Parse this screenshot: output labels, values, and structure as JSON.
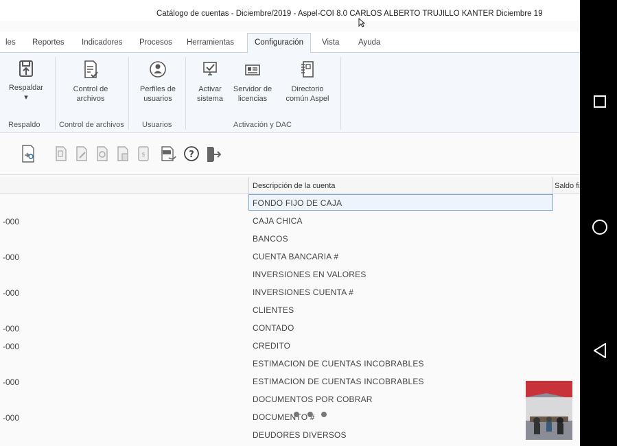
{
  "window": {
    "title": "Catálogo de cuentas - Diciembre/2019 - Aspel-COI 8.0 CARLOS ALBERTO TRUJILLO KANTER Diciembre 19"
  },
  "menu": [
    {
      "label": "les"
    },
    {
      "label": "Reportes"
    },
    {
      "label": "Indicadores"
    },
    {
      "label": "Procesos"
    },
    {
      "label": "Herramientas"
    },
    {
      "label": "Configuración"
    },
    {
      "label": "Vista"
    },
    {
      "label": "Ayuda"
    }
  ],
  "ribbon": {
    "buttons": [
      {
        "label": "Respaldar\n▾",
        "icon": "backup-icon"
      },
      {
        "label": "Control de\narchivos",
        "icon": "file-control-icon"
      },
      {
        "label": "Perfiles de\nusuarios",
        "icon": "user-profile-icon"
      },
      {
        "label": "Activar\nsistema",
        "icon": "activate-icon"
      },
      {
        "label": "Servidor de\nlicencias",
        "icon": "license-server-icon"
      },
      {
        "label": "Directorio\ncomún Aspel",
        "icon": "directory-icon"
      }
    ],
    "groups": [
      {
        "label": "Respaldo"
      },
      {
        "label": "Control de archivos"
      },
      {
        "label": "Usuarios"
      },
      {
        "label": "Activación y DAC"
      }
    ]
  },
  "grid": {
    "headers": {
      "description": "Descripción de la cuenta",
      "saldo": "Saldo fi"
    },
    "rows": [
      {
        "num": "",
        "desc": "FONDO FIJO DE CAJA"
      },
      {
        "num": "-000",
        "desc": "CAJA CHICA"
      },
      {
        "num": "",
        "desc": "BANCOS"
      },
      {
        "num": "-000",
        "desc": "CUENTA BANCARIA #"
      },
      {
        "num": "",
        "desc": "INVERSIONES EN VALORES"
      },
      {
        "num": "-000",
        "desc": "INVERSIONES CUENTA #"
      },
      {
        "num": "",
        "desc": "CLIENTES"
      },
      {
        "num": "-000",
        "desc": "CONTADO"
      },
      {
        "num": "-000",
        "desc": "CREDITO"
      },
      {
        "num": "",
        "desc": "ESTIMACION DE CUENTAS INCOBRABLES"
      },
      {
        "num": "-000",
        "desc": "ESTIMACION DE CUENTAS INCOBRABLES"
      },
      {
        "num": "",
        "desc": "DOCUMENTOS POR COBRAR"
      },
      {
        "num": "-000",
        "desc": "DOCUMENTO #"
      },
      {
        "num": "",
        "desc": "DEUDORES DIVERSOS"
      }
    ]
  },
  "colors": {
    "accent": "#2b6cb0",
    "selection_border": "#7aa3d6",
    "ribbon_bg": "#f4f7fb"
  }
}
